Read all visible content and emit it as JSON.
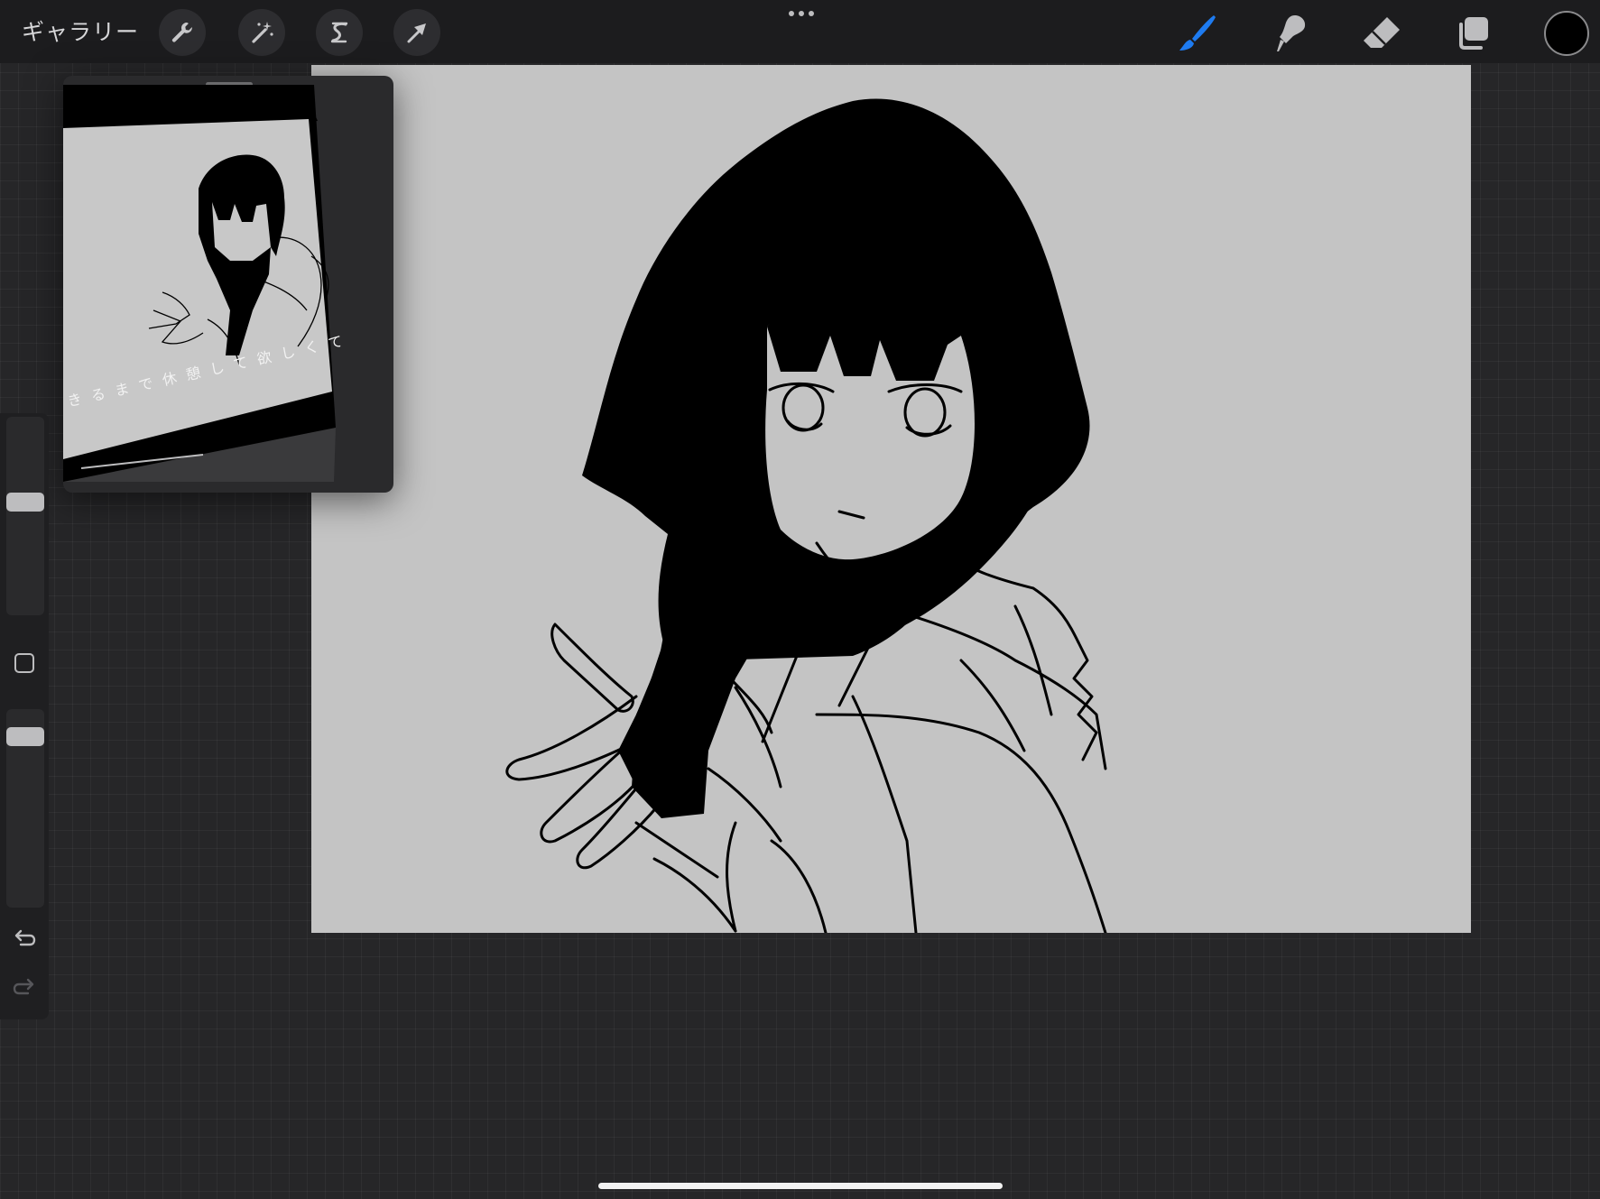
{
  "topbar": {
    "gallery_label": "ギャラリー",
    "left_tools": [
      {
        "name": "actions",
        "icon": "wrench-icon"
      },
      {
        "name": "adjustments",
        "icon": "magic-wand-icon"
      },
      {
        "name": "selection",
        "icon": "selection-s-icon"
      },
      {
        "name": "transform",
        "icon": "arrow-cursor-icon"
      }
    ],
    "right_tools": [
      {
        "name": "brush",
        "icon": "brush-icon",
        "active": true
      },
      {
        "name": "smudge",
        "icon": "smudge-icon",
        "active": false
      },
      {
        "name": "eraser",
        "icon": "eraser-icon",
        "active": false
      },
      {
        "name": "layers",
        "icon": "layers-icon",
        "active": false
      }
    ],
    "current_color": "#000000",
    "accent_color": "#1e7bf0"
  },
  "reference": {
    "caption": "きるまで休憩して欲しくて"
  },
  "sidebar": {
    "brush_size_level": 0.58,
    "opacity_level": 0.9,
    "undo_icon": "undo-icon",
    "redo_icon": "redo-icon"
  },
  "canvas": {
    "background": "#c4c4c4",
    "content": "line-art sketch of a girl with black hair reaching out a hand"
  }
}
